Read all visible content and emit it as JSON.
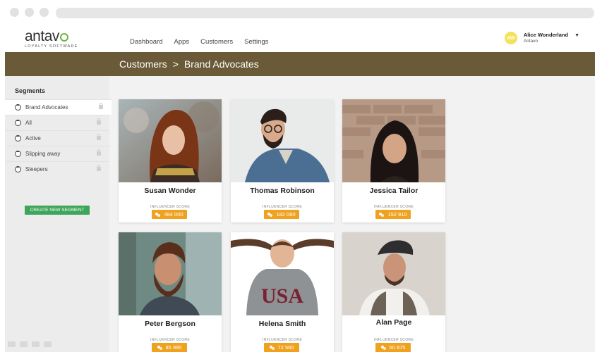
{
  "app": {
    "logo_main": "antav",
    "logo_sub": "LOYALTY SOFTWARE"
  },
  "nav": {
    "items": [
      "Dashboard",
      "Apps",
      "Customers",
      "Settings"
    ]
  },
  "user": {
    "initials": "AW",
    "name": "Alice Wonderland",
    "company": "Antavo"
  },
  "breadcrumb": {
    "parent": "Customers",
    "separator": ">",
    "current": "Brand Advocates"
  },
  "sidebar": {
    "title": "Segments",
    "items": [
      {
        "label": "Brand Advocates",
        "active": true
      },
      {
        "label": "All",
        "active": false
      },
      {
        "label": "Active",
        "active": false
      },
      {
        "label": "Slipping away",
        "active": false
      },
      {
        "label": "Sleepers",
        "active": false
      }
    ],
    "create_button": "CREATE NEW SEGMENT"
  },
  "cards": [
    {
      "name": "Susan Wonder",
      "score_label": "INFLUENCER SCORE",
      "score": "484 000"
    },
    {
      "name": "Thomas Robinson",
      "score_label": "INFLUENCER SCORE",
      "score": "182 060"
    },
    {
      "name": "Jessica Tailor",
      "score_label": "INFLUENCER SCORE",
      "score": "152 910"
    },
    {
      "name": "Peter Bergson",
      "score_label": "INFLUENCER SCORE",
      "score": "85 990"
    },
    {
      "name": "Helena Smith",
      "score_label": "INFLUENCER SCORE",
      "score": "72 560"
    },
    {
      "name": "Alan Page",
      "score_label": "INFLUENCER SCORE",
      "score": "50 875"
    }
  ],
  "colors": {
    "brand_bar": "#6a5a37",
    "accent_green": "#3ea65a",
    "score_orange": "#f0a21f",
    "avatar_yellow": "#f2e35a"
  }
}
